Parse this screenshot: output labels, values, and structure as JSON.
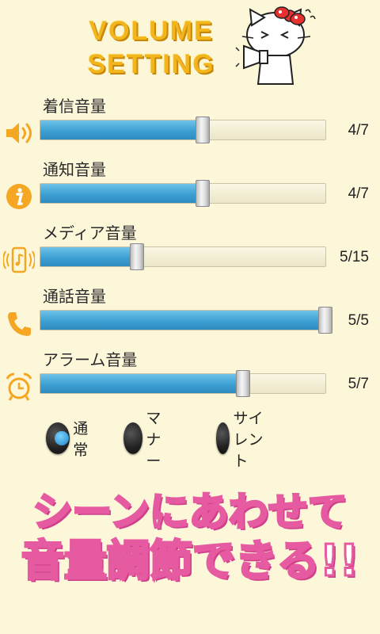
{
  "header": {
    "title_line1": "VOLUME",
    "title_line2": "SETTING"
  },
  "sliders": [
    {
      "label": "着信音量",
      "icon": "speaker-icon",
      "value_text": "4/7",
      "level": 0.57
    },
    {
      "label": "通知音量",
      "icon": "info-icon",
      "value_text": "4/7",
      "level": 0.57
    },
    {
      "label": "メディア音量",
      "icon": "music-phone-icon",
      "value_text": "5/15",
      "level": 0.34
    },
    {
      "label": "通話音量",
      "icon": "phone-icon",
      "value_text": "5/5",
      "level": 1.0
    },
    {
      "label": "アラーム音量",
      "icon": "alarm-clock-icon",
      "value_text": "5/7",
      "level": 0.71
    }
  ],
  "modes": [
    {
      "label": "通常",
      "selected": true
    },
    {
      "label": "マナー",
      "selected": false
    },
    {
      "label": "サイレント",
      "selected": false
    }
  ],
  "banner": {
    "line1": "シーンにあわせて",
    "line2": "音量調節できる!!"
  },
  "colors": {
    "background": "#fdf7d9",
    "accent_orange": "#f5a623",
    "slider_fill": "#3d9fd2",
    "banner_pink": "#e55aa0",
    "title_yellow": "#f2b51c"
  }
}
